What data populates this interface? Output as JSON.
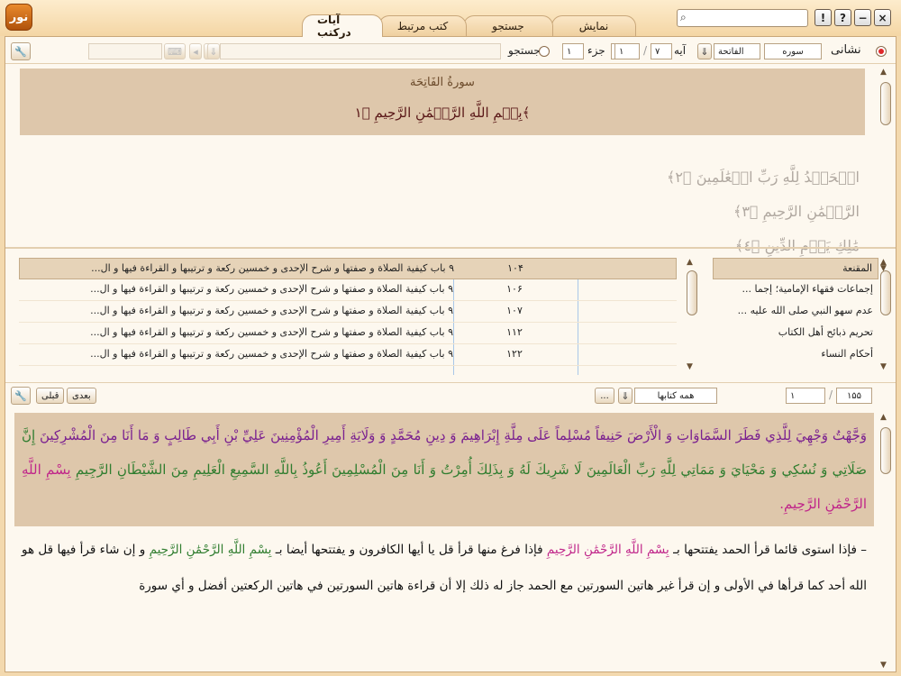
{
  "window": {
    "tabs": [
      "نمایش",
      "جستجو",
      "کتب مرتبط",
      "آيات درکتب"
    ],
    "active_tab": "آيات درکتب",
    "search_placeholder": "",
    "buttons": {
      "help": "?",
      "info": "!",
      "minimize": "−",
      "close": "×"
    },
    "logo_text": "نور"
  },
  "toolbar": {
    "mode_label": "نشانی",
    "type_value": "سوره",
    "surah_value": "الفاتحة",
    "ayah_label": "آیه",
    "ayah_from": "۱",
    "ayah_to": "۷",
    "juz_label": "جزء",
    "juz_value": "۱",
    "page_value": "۱",
    "search_label": "جستجو"
  },
  "quran": {
    "surah_title": "سورةُ الفَاتِحَة",
    "basmala": "بِسۡمِ اللَّهِ الرَّحۡمَٰنِ الرَّحِيمِ ﴿١﴾",
    "ayat": [
      "الۡحَمۡدُ لِلَّهِ رَبِّ الۡعَٰلَمِينَ ﴿٢﴾",
      "الرَّحۡمَٰنِ الرَّحِيمِ ﴿٣﴾",
      "مَٰلِكِ يَوۡمِ الدِّينِ ﴿٤﴾"
    ]
  },
  "results": {
    "rows": [
      {
        "text": "۹ باب كيفية الصلاة و صفتها و شرح الإحدى و خمسين ركعة و ترتيبها و القراءة فيها و ال...",
        "page": "۱۰۴"
      },
      {
        "text": "۹ باب كيفية الصلاة و صفتها و شرح الإحدى و خمسين ركعة و ترتيبها و القراءة فيها و ال...",
        "page": "۱۰۶"
      },
      {
        "text": "۹ باب كيفية الصلاة و صفتها و شرح الإحدى و خمسين ركعة و ترتيبها و القراءة فيها و ال...",
        "page": "۱۰۷"
      },
      {
        "text": "۹ باب كيفية الصلاة و صفتها و شرح الإحدى و خمسين ركعة و ترتيبها و القراءة فيها و ال...",
        "page": "۱۱۲"
      },
      {
        "text": "۹ باب كيفية الصلاة و صفتها و شرح الإحدى و خمسين ركعة و ترتيبها و القراءة فيها و ال...",
        "page": "۱۲۲"
      }
    ]
  },
  "books": {
    "header": "المقنعة",
    "items": [
      "إجماعات فقهاء الإمامية؛ إجما ...",
      "عدم سهو النبي صلى الله عليه ...",
      "تحريم ذبائح أهل الكتاب",
      "أحكام النساء"
    ]
  },
  "toolbar2": {
    "next_label": "بعدی",
    "prev_label": "قبلی",
    "all_books_value": "همه کتابها",
    "more_label": "...",
    "page_current": "۱",
    "page_total": "۱۵۵"
  },
  "hadith": {
    "highlight_parts": [
      "وَجَّهْتُ وَجْهِيَ لِلَّذِي فَطَرَ السَّمَاوَاتِ وَ الْأَرْضَ حَنِيفاً مُسْلِماً عَلَى مِلَّةِ إِبْرَاهِيمَ وَ دِينِ مُحَمَّدٍ وَ وَلَايَةِ أَمِيرِ الْمُؤْمِنِينَ عَلِيِّ بْنِ أَبِي طَالِبٍ وَ مَا أَنَا مِنَ الْمُشْرِكِينَ",
      "إِنَّ صَلَاتِي وَ نُسُكِي وَ مَحْيَايَ وَ مَمَاتِي لِلَّهِ رَبِّ الْعَالَمِينَ لَا شَرِيكَ لَهُ وَ بِذَلِكَ أُمِرْتُ وَ أَنَا مِنَ الْمُسْلِمِينَ أَعُوذُ بِاللَّهِ السَّمِيعِ الْعَلِيمِ مِنَ الشَّيْطَانِ الرَّجِيمِ",
      "بِسْمِ اللَّهِ الرَّحْمَٰنِ الرَّحِيمِ."
    ],
    "body_parts": [
      "– فإذا استوى قائما قرأ الحمد يفتتحها بـ",
      "بِسْمِ اللَّهِ الرَّحْمَٰنِ الرَّحِيمِ",
      " فإذا فرغ منها قرأ قل يا أيها الكافرون و يفتتحها أيضا بـ",
      "بِسْمِ اللَّهِ الرَّحْمَٰنِ الرَّحِيمِ",
      " و إن شاء قرأ فيها قل هو الله أحد كما قرأها في الأولى و إن قرأ غير هاتين السورتين مع الحمد جاز له ذلك إلا أن قراءة هاتين السورتين في هاتين الركعتين أفضل و أي سورة"
    ]
  },
  "colors": {
    "background": "#f3d9ae",
    "panel": "#fdf8ef",
    "highlight": "#dec7ab",
    "quran_green": "#2f7d2f",
    "basmala_pink": "#c0268a",
    "hadith_purple": "#7a2090"
  }
}
